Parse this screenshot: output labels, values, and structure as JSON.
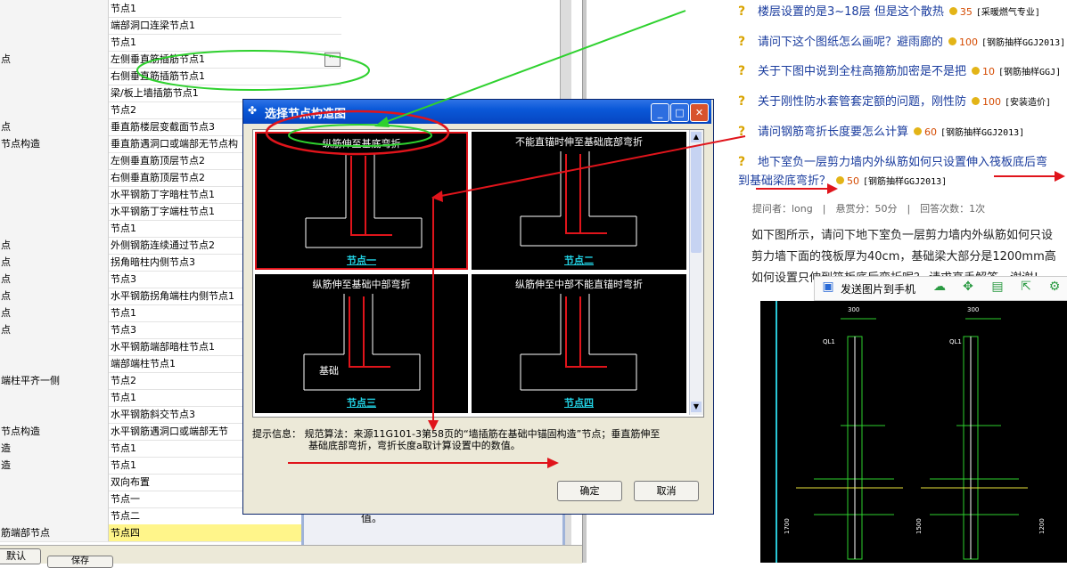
{
  "table": {
    "rows": [
      {
        "label": "",
        "value": "节点1"
      },
      {
        "label": "",
        "value": "端部洞口连梁节点1"
      },
      {
        "label": "",
        "value": "节点1"
      },
      {
        "label": "点",
        "value": "左侧垂直筋插筋节点1"
      },
      {
        "label": "",
        "value": "右侧垂直筋插筋节点1"
      },
      {
        "label": "",
        "value": "梁/板上墙插筋节点1"
      },
      {
        "label": "",
        "value": "节点2"
      },
      {
        "label": "点",
        "value": "垂直筋楼层变截面节点3"
      },
      {
        "label": "节点构造",
        "value": "垂直筋遇洞口或端部无节点构"
      },
      {
        "label": "",
        "value": "左侧垂直筋顶层节点2"
      },
      {
        "label": "",
        "value": "右侧垂直筋顶层节点2"
      },
      {
        "label": "",
        "value": "水平钢筋丁字暗柱节点1"
      },
      {
        "label": "",
        "value": "水平钢筋丁字端柱节点1"
      },
      {
        "label": "",
        "value": "节点1"
      },
      {
        "label": "点",
        "value": "外侧钢筋连续通过节点2"
      },
      {
        "label": "点",
        "value": "拐角暗柱内侧节点3"
      },
      {
        "label": "点",
        "value": "节点3"
      },
      {
        "label": "点",
        "value": "水平钢筋拐角端柱内侧节点1"
      },
      {
        "label": "点",
        "value": "节点1"
      },
      {
        "label": "点",
        "value": "节点3"
      },
      {
        "label": "",
        "value": "水平钢筋端部暗柱节点1"
      },
      {
        "label": "",
        "value": "端部端柱节点1"
      },
      {
        "label": "端柱平齐一侧",
        "value": "节点2"
      },
      {
        "label": "",
        "value": "节点1"
      },
      {
        "label": "",
        "value": "水平钢筋斜交节点3"
      },
      {
        "label": "节点构造",
        "value": "水平钢筋遇洞口或端部无节"
      },
      {
        "label": "造",
        "value": "节点1"
      },
      {
        "label": "造",
        "value": "节点1"
      },
      {
        "label": "",
        "value": "双向布置"
      },
      {
        "label": "",
        "value": "节点一"
      },
      {
        "label": "",
        "value": "节点二"
      },
      {
        "label": "筋端部节点",
        "value": "节点四"
      }
    ],
    "ellipsis": "···"
  },
  "middle": {
    "value_text": "值。"
  },
  "bottom": {
    "btn_a": "默认",
    "btn_b": "保存"
  },
  "dialog": {
    "title": "选择节点构造图",
    "minimize": "_",
    "maximize": "□",
    "close": "✕",
    "panels": [
      {
        "title": "纵筋伸至基底弯折",
        "label": "节点一"
      },
      {
        "title": "不能直锚时伸至基础底部弯折",
        "label": "节点二"
      },
      {
        "title": "纵筋伸至基础中部弯折",
        "label": "节点三"
      },
      {
        "title": "纵筋伸至中部不能直锚时弯折",
        "label": "节点四"
      }
    ],
    "basis_label": "基础",
    "hint_line1": "提示信息： 规范算法：来源11G101-3第58页的“墙插筋在基础中锚固构造”节点；垂直筋伸至",
    "hint_line2": "基础底部弯折，弯折长度a取计算设置中的数值。",
    "ok": "确定",
    "cancel": "取消"
  },
  "forum": {
    "questions": [
      {
        "text": "楼层设置的是3~18层 但是这个散热",
        "score": "35",
        "tag": "[采暖燃气专业]"
      },
      {
        "text": "请问下这个图纸怎么画呢？避雨廊的",
        "score": "100",
        "tag": "[钢筋抽样GGJ2013]"
      },
      {
        "text": "关于下图中说到全柱高箍筋加密是不是把",
        "score": "10",
        "tag": "[钢筋抽样GGJ]"
      },
      {
        "text": "关于刚性防水套管套定额的问题，刚性防",
        "score": "100",
        "tag": "[安装造价]"
      },
      {
        "text": "请问钢筋弯折长度要怎么计算",
        "score": "60",
        "tag": "[钢筋抽样GGJ2013]"
      },
      {
        "text": "地下室负一层剪力墙内外纵筋如何只设置伸入筏板底后弯",
        "score": "",
        "tag": ""
      }
    ],
    "q6_line2": "到基础梁底弯折？",
    "q6_score": "50",
    "q6_tag": "[钢筋抽样GGJ2013]",
    "meta": "提问者：long　|　悬赏分：50分　|　回答次数：1次",
    "body_line1": "如下图所示，请问下地下室负一层剪力墙内外纵筋如何只设",
    "body_line2": "剪力墙下面的筏板厚为40cm，基础梁大部分是1200mm高",
    "body_line3": "如何设置只伸到筏板底后弯折呢？ 请求高手解答，谢谢！",
    "toolbar_label": "发送图片到手机",
    "drawing_labels": [
      "300",
      "300",
      "QL1",
      "QL1",
      "1700",
      "1500",
      "1200"
    ]
  },
  "colors": {
    "accent_red": "#e0141b",
    "accent_green": "#2ed12e",
    "link_blue": "#1a3c9e",
    "dialog_blue": "#0a58d8"
  }
}
